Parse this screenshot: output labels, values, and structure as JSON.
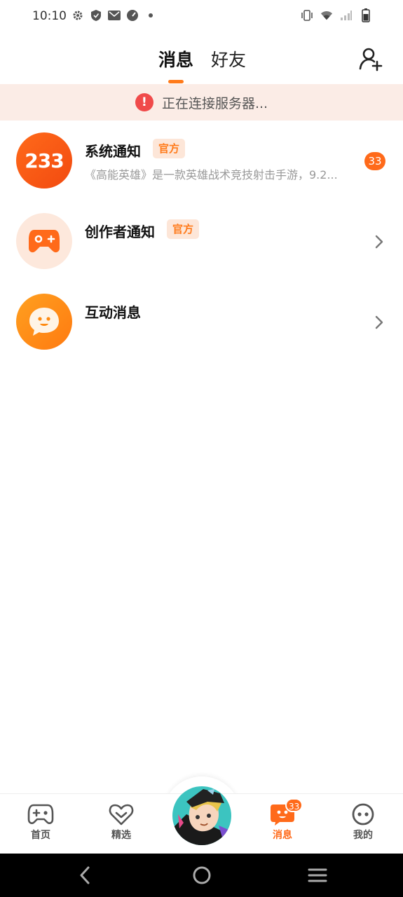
{
  "status_bar": {
    "time": "10:10",
    "left_icons": [
      "gear-icon",
      "shield-icon",
      "mail-icon",
      "speedometer-icon",
      "dot-icon"
    ],
    "right_icons": [
      "vibrate-icon",
      "wifi-icon",
      "signal-icon",
      "battery-icon"
    ]
  },
  "header": {
    "tabs": [
      {
        "label": "消息",
        "active": true
      },
      {
        "label": "好友",
        "active": false
      }
    ],
    "add_friend_icon": "add-person-icon"
  },
  "banner": {
    "icon": "exclamation-icon",
    "text": "正在连接服务器..."
  },
  "messages": [
    {
      "title": "系统通知",
      "badge": "官方",
      "preview": "《高能英雄》是一款英雄战术竞技射击手游，9.2...",
      "count": "33",
      "avatar_text": "233"
    },
    {
      "title": "创作者通知",
      "badge": "官方",
      "preview": "",
      "avatar_icon": "gamepad-icon"
    },
    {
      "title": "互动消息",
      "preview": "",
      "avatar_icon": "chat-face-icon"
    }
  ],
  "bottom_nav": {
    "items": [
      {
        "label": "首页",
        "icon": "gamepad-icon"
      },
      {
        "label": "精选",
        "icon": "heart-icon"
      },
      {
        "label": "消息",
        "icon": "message-icon",
        "badge": "33",
        "active": true
      },
      {
        "label": "我的",
        "icon": "face-icon"
      }
    ]
  },
  "colors": {
    "accent": "#ff6a1a",
    "banner_bg": "#fbece6",
    "alert_red": "#f04a4a"
  }
}
